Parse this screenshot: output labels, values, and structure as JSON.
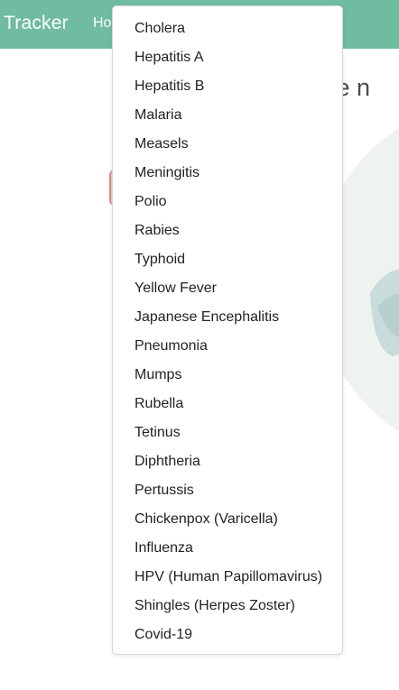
{
  "navbar": {
    "brand": "Tracker",
    "home_link": "Ho"
  },
  "hero": {
    "title_fragment": "me n"
  },
  "colors": {
    "navbar_bg": "#6fbca1",
    "globe": "#a9c9c9"
  },
  "dropdown": {
    "items": [
      "Cholera",
      "Hepatitis A",
      "Hepatitis B",
      "Malaria",
      "Measels",
      "Meningitis",
      "Polio",
      "Rabies",
      "Typhoid",
      "Yellow Fever",
      "Japanese Encephalitis",
      "Pneumonia",
      "Mumps",
      "Rubella",
      "Tetinus",
      "Diphtheria",
      "Pertussis",
      "Chickenpox (Varicella)",
      "Influenza",
      "HPV (Human Papillomavirus)",
      "Shingles (Herpes Zoster)",
      "Covid-19"
    ]
  }
}
